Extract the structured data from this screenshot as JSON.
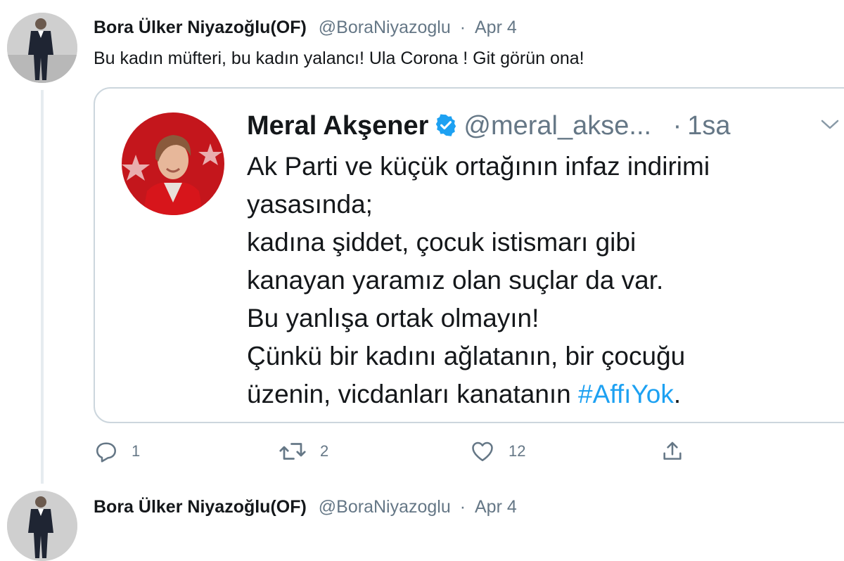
{
  "tweet_1": {
    "author_name": "Bora Ülker Niyazoğlu(OF)",
    "author_handle": "@BoraNiyazoglu",
    "separator": "·",
    "date": "Apr 4",
    "text": "Bu kadın müfteri, bu kadın yalancı! Ula Corona ! Git görün ona!",
    "avatar_icon": "person-photo-avatar"
  },
  "quoted_tweet": {
    "author_name": "Meral Akşener",
    "verified_icon": "verified-badge-icon",
    "author_handle": "@meral_akse...",
    "separator": "·",
    "time": "1sa",
    "menu_icon": "chevron-down-icon",
    "avatar_icon": "portrait-photo-avatar",
    "lines": [
      "Ak Parti ve küçük ortağının infaz indirimi",
      "yasasında;",
      "kadına şiddet, çocuk istismarı gibi",
      "kanayan yaramız olan suçlar da var.",
      "Bu yanlışa ortak olmayın!",
      "Çünkü bir kadını ağlatanın, bir çocuğu",
      "üzenin, vicdanları kanatanın "
    ],
    "hashtag": "#AffıYok",
    "end_punct": "."
  },
  "actions": {
    "reply_icon": "reply-icon",
    "reply_count": "1",
    "retweet_icon": "retweet-icon",
    "retweet_count": "2",
    "like_icon": "heart-icon",
    "like_count": "12",
    "share_icon": "share-icon"
  },
  "tweet_2": {
    "author_name": "Bora Ülker Niyazoğlu(OF)",
    "author_handle": "@BoraNiyazoglu",
    "separator": "·",
    "date": "Apr 4"
  },
  "colors": {
    "link": "#1da1f2",
    "muted": "#657786",
    "text": "#14171a",
    "border": "#ccd6dd"
  }
}
